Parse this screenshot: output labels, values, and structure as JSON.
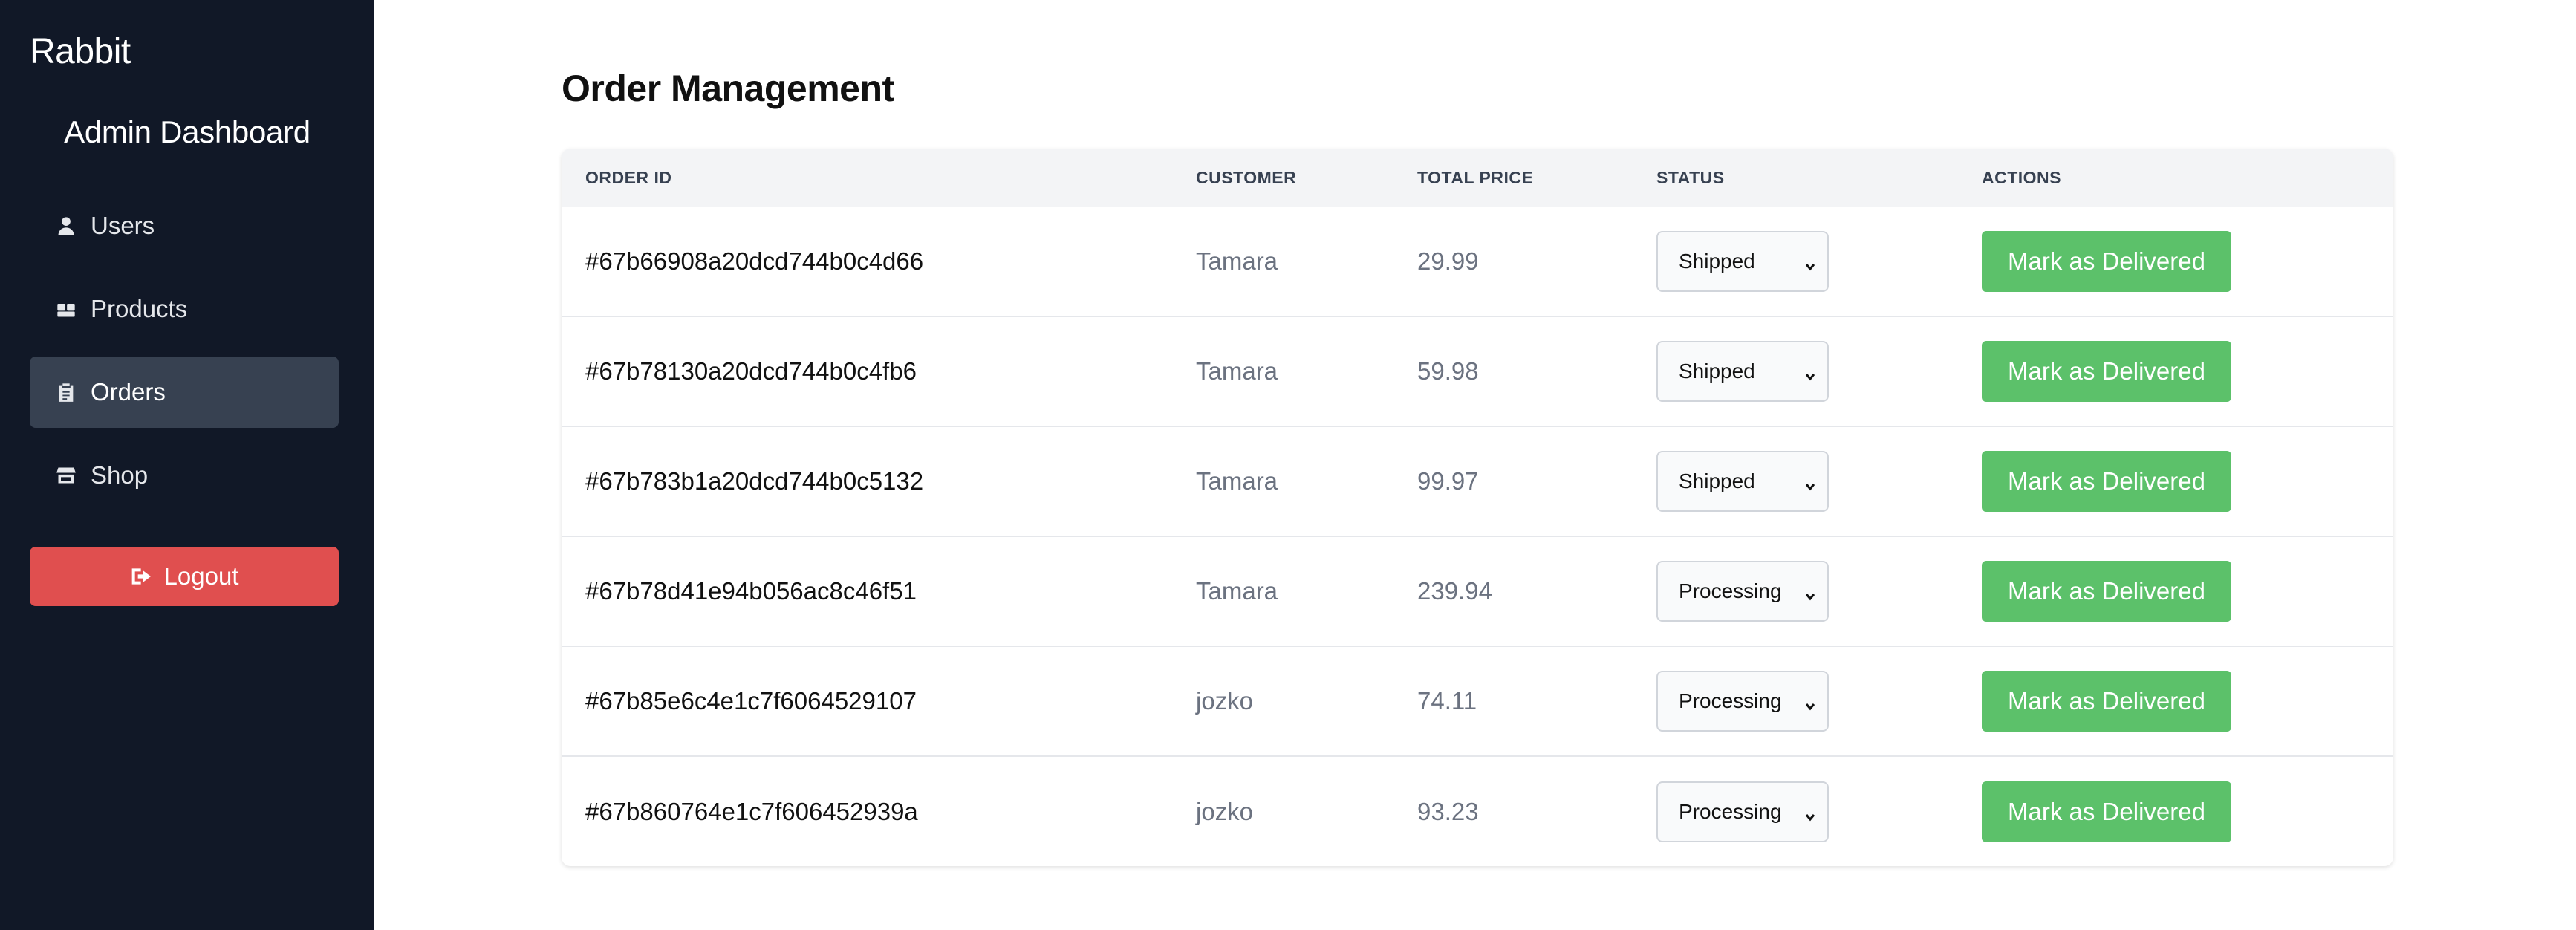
{
  "sidebar": {
    "brand": "Rabbit",
    "title": "Admin Dashboard",
    "items": [
      {
        "label": "Users",
        "icon": "user-icon",
        "active": false
      },
      {
        "label": "Products",
        "icon": "boxes-icon",
        "active": false
      },
      {
        "label": "Orders",
        "icon": "clipboard-icon",
        "active": true
      },
      {
        "label": "Shop",
        "icon": "store-icon",
        "active": false
      }
    ],
    "logout_label": "Logout"
  },
  "main": {
    "title": "Order Management",
    "columns": [
      "ORDER ID",
      "CUSTOMER",
      "TOTAL PRICE",
      "STATUS",
      "ACTIONS"
    ],
    "action_label": "Mark as Delivered",
    "orders": [
      {
        "id": "#67b66908a20dcd744b0c4d66",
        "customer": "Tamara",
        "total": "29.99",
        "status": "Shipped"
      },
      {
        "id": "#67b78130a20dcd744b0c4fb6",
        "customer": "Tamara",
        "total": "59.98",
        "status": "Shipped"
      },
      {
        "id": "#67b783b1a20dcd744b0c5132",
        "customer": "Tamara",
        "total": "99.97",
        "status": "Shipped"
      },
      {
        "id": "#67b78d41e94b056ac8c46f51",
        "customer": "Tamara",
        "total": "239.94",
        "status": "Processing"
      },
      {
        "id": "#67b85e6c4e1c7f6064529107",
        "customer": "jozko",
        "total": "74.11",
        "status": "Processing"
      },
      {
        "id": "#67b860764e1c7f606452939a",
        "customer": "jozko",
        "total": "93.23",
        "status": "Processing"
      }
    ]
  },
  "colors": {
    "sidebar_bg": "#111827",
    "active_item_bg": "#374151",
    "logout_bg": "#e04f4f",
    "deliver_btn_bg": "#5cc16a"
  }
}
